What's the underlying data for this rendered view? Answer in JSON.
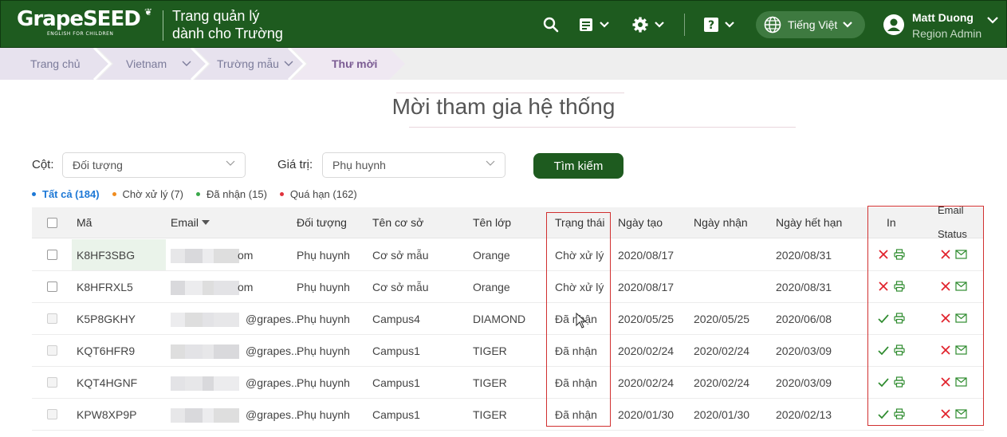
{
  "header": {
    "logo_text": "GrapeSEED",
    "logo_sub": "ENGLISH FOR CHILDREN",
    "portal_title_line1": "Trang quản lý",
    "portal_title_line2": "dành cho Trường",
    "language": "Tiếng Việt",
    "user_name": "Matt Duong",
    "user_role": "Region Admin",
    "icons": [
      "search-icon",
      "document-icon",
      "gear-icon",
      "help-icon",
      "globe-icon",
      "user-icon"
    ]
  },
  "breadcrumb": {
    "items": [
      {
        "label": "Trang chủ",
        "has_dropdown": false
      },
      {
        "label": "Vietnam",
        "has_dropdown": true
      },
      {
        "label": "Trường mẫu",
        "has_dropdown": true
      },
      {
        "label": "Thư mời",
        "has_dropdown": false,
        "active": true
      }
    ]
  },
  "page": {
    "title": "Mời tham gia hệ thống"
  },
  "filters": {
    "column_label": "Cột:",
    "column_value": "Đối tượng",
    "value_label": "Giá trị:",
    "value_value": "Phụ huynh",
    "search_button": "Tìm kiếm"
  },
  "status_tabs": [
    {
      "label": "Tất cả (184)",
      "color": "#1d78d6",
      "active": true
    },
    {
      "label": "Chờ xử lý (7)",
      "color": "#f08c1e",
      "active": false
    },
    {
      "label": "Đã nhận (15)",
      "color": "#3aa84a",
      "active": false
    },
    {
      "label": "Quá hạn (162)",
      "color": "#e0323c",
      "active": false
    }
  ],
  "table": {
    "columns": {
      "code": "Mã",
      "email": "Email",
      "target": "Đối tượng",
      "campus": "Tên cơ sở",
      "class": "Tên lớp",
      "status": "Trạng thái",
      "created": "Ngày tạo",
      "received": "Ngày nhận",
      "expiry": "Ngày hết hạn",
      "print": "In",
      "email_status_line1": "Email",
      "email_status_line2": "Status"
    },
    "rows": [
      {
        "code": "K8HF3SBG",
        "email": "om",
        "target": "Phụ huynh",
        "campus": "Cơ sở mẫu",
        "class": "Orange",
        "status": "Chờ xử lý",
        "created": "2020/08/17",
        "received": "",
        "expiry": "2020/08/31",
        "printed": false
      },
      {
        "code": "K8HFRXL5",
        "email": "om",
        "target": "Phụ huynh",
        "campus": "Cơ sở mẫu",
        "class": "Orange",
        "status": "Chờ xử lý",
        "created": "2020/08/17",
        "received": "",
        "expiry": "2020/08/31",
        "printed": false
      },
      {
        "code": "K5P8GKHY",
        "email": "@grapes...",
        "target": "Phụ huynh",
        "campus": "Campus4",
        "class": "DIAMOND",
        "status": "Đã nhận",
        "created": "2020/05/25",
        "received": "2020/05/25",
        "expiry": "2020/06/08",
        "printed": true
      },
      {
        "code": "KQT6HFR9",
        "email": "@grapes...",
        "target": "Phụ huynh",
        "campus": "Campus1",
        "class": "TIGER",
        "status": "Đã nhận",
        "created": "2020/02/24",
        "received": "2020/02/24",
        "expiry": "2020/03/09",
        "printed": true
      },
      {
        "code": "KQT4HGNF",
        "email": "@grapes...",
        "target": "Phụ huynh",
        "campus": "Campus1",
        "class": "TIGER",
        "status": "Đã nhận",
        "created": "2020/02/24",
        "received": "2020/02/24",
        "expiry": "2020/03/09",
        "printed": true
      },
      {
        "code": "KPW8XP9P",
        "email": "@grapes...",
        "target": "Phụ huynh",
        "campus": "Campus1",
        "class": "TIGER",
        "status": "Đã nhận",
        "created": "2020/01/30",
        "received": "2020/01/30",
        "expiry": "2020/02/13",
        "printed": true
      }
    ]
  },
  "colors": {
    "brand_green": "#1e5b1f",
    "breadcrumb_bg": "#eeeeee",
    "breadcrumb_active": "#efe8f2",
    "annotation_red": "#d13030",
    "check_green": "#2e8b2e",
    "cross_red": "#e0202a"
  }
}
